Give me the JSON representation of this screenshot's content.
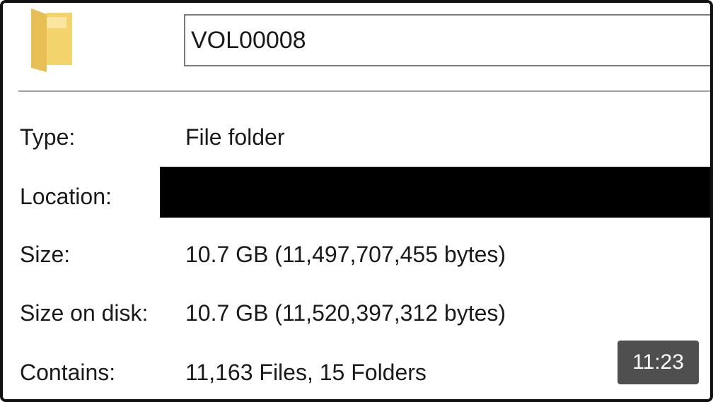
{
  "folder": {
    "icon": "folder-icon",
    "name_value": "VOL00008"
  },
  "properties": {
    "type_label": "Type:",
    "type_value": "File folder",
    "location_label": "Location:",
    "size_label": "Size:",
    "size_value": "10.7 GB (11,497,707,455 bytes)",
    "size_on_disk_label": "Size on disk:",
    "size_on_disk_value": "10.7 GB (11,520,397,312 bytes)",
    "contains_label": "Contains:",
    "contains_value": "11,163 Files, 15 Folders"
  },
  "video": {
    "timestamp": "11:23"
  },
  "colors": {
    "folder_yellow": "#f3d36b",
    "folder_light": "#fbe6a0",
    "redaction": "#000000"
  }
}
